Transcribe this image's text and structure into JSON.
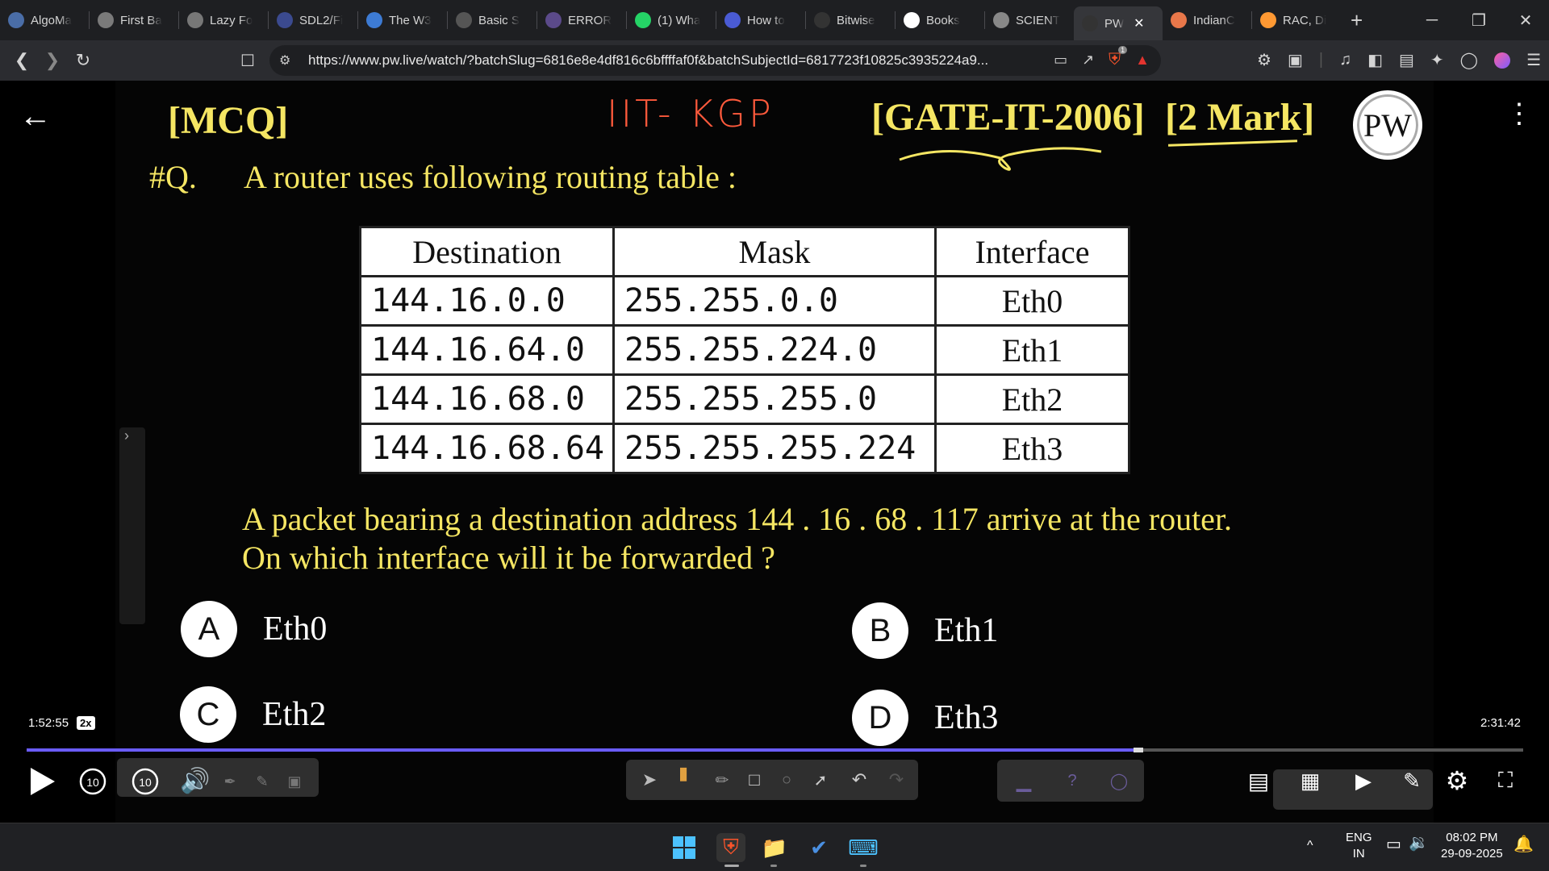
{
  "browser": {
    "tabs": [
      {
        "label": "AlgoMa",
        "icon": "algomaster-icon",
        "color": "#4a6da7"
      },
      {
        "label": "First Ba",
        "icon": "timer-icon",
        "color": "#7a7a7a"
      },
      {
        "label": "Lazy Fo",
        "icon": "lazyfoo-icon",
        "color": "#777"
      },
      {
        "label": "SDL2/Fi",
        "icon": "sdl-icon",
        "color": "#3b4a8f"
      },
      {
        "label": "The W3",
        "icon": "w3-icon",
        "color": "#3d7bd4"
      },
      {
        "label": "Basic S",
        "icon": "basic-icon",
        "color": "#555"
      },
      {
        "label": "ERROR",
        "icon": "error-icon",
        "color": "#5b4a8a"
      },
      {
        "label": "(1) Wha",
        "icon": "whatsapp-icon",
        "color": "#25d366"
      },
      {
        "label": "How to",
        "icon": "howto-icon",
        "color": "#4a5bd4"
      },
      {
        "label": "Bitwise",
        "icon": "bitwise-icon",
        "color": "#333"
      },
      {
        "label": "Books",
        "icon": "google-icon",
        "color": "#fff"
      },
      {
        "label": "SCIENT",
        "icon": "science-icon",
        "color": "#888"
      },
      {
        "label": "PW",
        "icon": "pw-icon",
        "color": "#333",
        "active": true
      },
      {
        "label": "IndianC",
        "icon": "indian-icon",
        "color": "#e8774a"
      },
      {
        "label": "RAC, Di",
        "icon": "flag-icon",
        "color": "#ff9933"
      }
    ],
    "url": "https://www.pw.live/watch/?batchSlug=6816e8e4df816c6bffffaf0f&batchSubjectId=6817723f10825c3935224a9...",
    "brave_badge": "1"
  },
  "slide": {
    "tag": "[MCQ]",
    "handwritten": "IIT- KGP",
    "gate": "[GATE-IT-2006]",
    "marks": "[2 Mark]",
    "logo": "PW",
    "qnum": "#Q.",
    "question": "A router uses following routing table :",
    "table": {
      "headers": [
        "Destination",
        "Mask",
        "Interface"
      ],
      "rows": [
        [
          "144.16.0.0",
          "255.255.0.0",
          "Eth0"
        ],
        [
          "144.16.64.0",
          "255.255.224.0",
          "Eth1"
        ],
        [
          "144.16.68.0",
          "255.255.255.0",
          "Eth2"
        ],
        [
          "144.16.68.64",
          "255.255.255.224",
          "Eth3"
        ]
      ]
    },
    "packet_line1": "A packet bearing a destination address 144 . 16 . 68 . 117 arrive at the router.",
    "packet_line2": "On which interface will it be forwarded ?",
    "options": [
      {
        "letter": "A",
        "text": "Eth0"
      },
      {
        "letter": "B",
        "text": "Eth1"
      },
      {
        "letter": "C",
        "text": "Eth2"
      },
      {
        "letter": "D",
        "text": "Eth3"
      }
    ]
  },
  "player": {
    "current_time": "1:52:55",
    "speed": "2x",
    "total_time": "2:31:42",
    "progress_fraction": 0.7409,
    "rewind": "10",
    "forward": "10"
  },
  "taskbar": {
    "lang_top": "ENG",
    "lang_bottom": "IN",
    "time": "08:02 PM",
    "date": "29-09-2025"
  }
}
